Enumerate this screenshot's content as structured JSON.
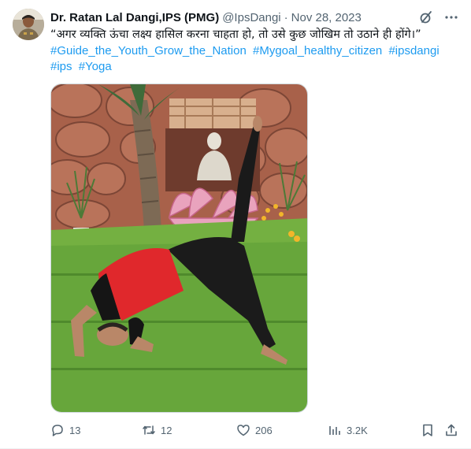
{
  "author": {
    "name": "Dr. Ratan Lal Dangi,IPS (PMG)",
    "handle": "@IpsDangi",
    "separator": "·",
    "date": "Nov 28, 2023"
  },
  "post": {
    "text": "“अगर व्यक्ति ऊंचा लक्ष्य हासिल करना चाहता हो, तो उसे कुछ जोखिम तो उठाने ही होंगे।”",
    "hashtags": [
      "#Guide_the_Youth_Grow_the_Nation",
      "#Mygoal_healthy_citizen",
      "#ipsdangi",
      "#ips",
      "#Yoga"
    ]
  },
  "actions": {
    "replies": "13",
    "reposts": "12",
    "likes": "206",
    "views": "3.2K"
  },
  "icons": {
    "grok": "grok-icon",
    "more": "more-icon",
    "reply": "reply-icon",
    "repost": "repost-icon",
    "like": "heart-icon",
    "views": "analytics-icon",
    "bookmark": "bookmark-icon",
    "share": "share-icon"
  },
  "colors": {
    "text": "#0f1419",
    "secondary": "#536471",
    "link": "#1d9bf0",
    "border": "#cfd9de"
  }
}
